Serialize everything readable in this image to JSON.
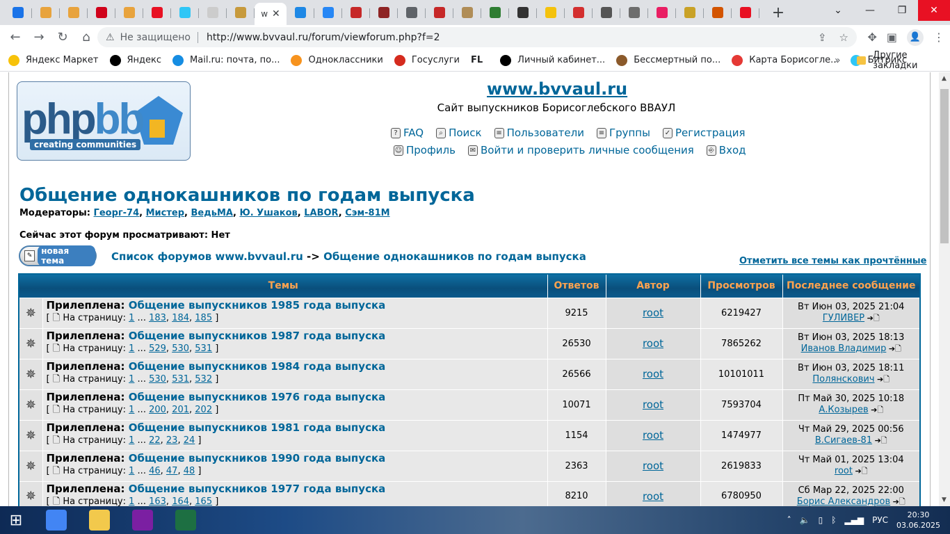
{
  "browser": {
    "active_tab_title": "w",
    "tabs": [
      {
        "icon": "chat-icon",
        "color": "#1a73e8"
      },
      {
        "icon": "mt-icon",
        "color": "#e8a33d"
      },
      {
        "icon": "mt-icon",
        "color": "#e8a33d"
      },
      {
        "icon": "star-icon",
        "color": "#d0021b"
      },
      {
        "icon": "mt-icon",
        "color": "#e8a33d"
      },
      {
        "icon": "red-circle-icon",
        "color": "#e81123"
      },
      {
        "icon": "bitrix24-icon",
        "color": "#2fc6f6"
      },
      {
        "icon": "yandex-icon",
        "color": "#cccccc"
      },
      {
        "icon": "sunburst-icon",
        "color": "#c79a3c"
      }
    ],
    "tabs_right": [
      {
        "icon": "ibb-icon",
        "color": "#1e88e5"
      },
      {
        "icon": "vk-icon",
        "color": "#2787f5"
      },
      {
        "icon": "red-star-icon",
        "color": "#c62828"
      },
      {
        "icon": "red-star-icon",
        "color": "#8e2424"
      },
      {
        "icon": "globe-icon",
        "color": "#5f6368"
      },
      {
        "icon": "mascot-icon",
        "color": "#c62828"
      },
      {
        "icon": "book-icon",
        "color": "#b08d57"
      },
      {
        "icon": "triangle-icon",
        "color": "#2e7d32"
      },
      {
        "icon": "b28-icon",
        "color": "#333333"
      },
      {
        "icon": "smile-icon",
        "color": "#f4c20d"
      },
      {
        "icon": "m-icon",
        "color": "#d32f2f"
      },
      {
        "icon": "u-icon",
        "color": "#555555"
      },
      {
        "icon": "people-icon",
        "color": "#6d6d6d"
      },
      {
        "icon": "b-icon",
        "color": "#e91e63"
      },
      {
        "icon": "flag-icon",
        "color": "#c9a227"
      },
      {
        "icon": "rss-icon",
        "color": "#d35400"
      },
      {
        "icon": "red-circle-icon",
        "color": "#e81123"
      }
    ],
    "address": {
      "insecure_label": "Не защищено",
      "url": "http://www.bvvaul.ru/forum/viewforum.php?f=2"
    },
    "bookmarks": [
      {
        "label": "Яндекс Маркет",
        "color": "#f7c20a"
      },
      {
        "label": "Яндекс",
        "color": "#000000"
      },
      {
        "label": "Mail.ru: почта, по...",
        "color": "#168de2"
      },
      {
        "label": "Одноклассники",
        "color": "#f7931e"
      },
      {
        "label": "Госуслуги",
        "color": "#d52b1e"
      },
      {
        "label": "Личный кабинет...",
        "color": "#000000"
      },
      {
        "label": "Бессмертный по...",
        "color": "#8b5a2b"
      },
      {
        "label": "Карта Борисогле...",
        "color": "#e53935"
      },
      {
        "label": "Битрикс",
        "color": "#2fc6f6"
      }
    ],
    "bookmark_fl_label": "FL",
    "other_bookmarks": "Другие закладки"
  },
  "site": {
    "logo_text_php": "php",
    "logo_text_bb": "bb",
    "logo_tagline": "creating communities",
    "title": "www.bvvaul.ru",
    "description": "Сайт выпускников Борисоглебского ВВАУЛ",
    "nav_top": [
      "FAQ",
      "Поиск",
      "Пользователи",
      "Группы",
      "Регистрация"
    ],
    "nav_bottom": [
      "Профиль",
      "Войти и проверить личные сообщения",
      "Вход"
    ]
  },
  "forum": {
    "title": "Общение однокашников по годам выпуска",
    "moderators_label": "Модераторы:",
    "moderators": [
      "Георг-74",
      "Мистер",
      "ВедьМА",
      "Ю. Ушаков",
      "LABOR",
      "Сэм-81М"
    ],
    "viewing": "Сейчас этот форум просматривают: Нет",
    "new_topic_label": "новая тема",
    "crumb_index": "Список форумов www.bvvaul.ru",
    "crumb_sep": "->",
    "crumb_current": "Общение однокашников по годам выпуска",
    "mark_read": "Отметить все темы как прочтённые",
    "columns": [
      "Темы",
      "Ответов",
      "Автор",
      "Просмотров",
      "Последнее сообщение"
    ],
    "sticky_prefix": "Прилеплена:",
    "pages_label": "На страницу:",
    "rows": [
      {
        "title": "Общение выпускников 1985 года выпуска",
        "pages": [
          "1",
          "183",
          "184",
          "185"
        ],
        "replies": "9215",
        "author": "root",
        "views": "6219427",
        "last_date": "Вт Июн 03, 2025 21:04",
        "last_user": "ГУЛИВЕР"
      },
      {
        "title": "Общение выпускников 1987 года выпуска",
        "pages": [
          "1",
          "529",
          "530",
          "531"
        ],
        "replies": "26530",
        "author": "root",
        "views": "7865262",
        "last_date": "Вт Июн 03, 2025 18:13",
        "last_user": "Иванов Владимир"
      },
      {
        "title": "Общение выпускников 1984 года выпуска",
        "pages": [
          "1",
          "530",
          "531",
          "532"
        ],
        "replies": "26566",
        "author": "root",
        "views": "10101011",
        "last_date": "Вт Июн 03, 2025 18:11",
        "last_user": "Полянскович"
      },
      {
        "title": "Общение выпускников 1976 года выпуска",
        "pages": [
          "1",
          "200",
          "201",
          "202"
        ],
        "replies": "10071",
        "author": "root",
        "views": "7593704",
        "last_date": "Пт Май 30, 2025 10:18",
        "last_user": "А.Козырев"
      },
      {
        "title": "Общение выпускников 1981 года выпуска",
        "pages": [
          "1",
          "22",
          "23",
          "24"
        ],
        "replies": "1154",
        "author": "root",
        "views": "1474977",
        "last_date": "Чт Май 29, 2025 00:56",
        "last_user": "В.Сигаев-81"
      },
      {
        "title": "Общение выпускников 1990 года выпуска",
        "pages": [
          "1",
          "46",
          "47",
          "48"
        ],
        "replies": "2363",
        "author": "root",
        "views": "2619833",
        "last_date": "Чт Май 01, 2025 13:04",
        "last_user": "root"
      },
      {
        "title": "Общение выпускников 1977 года выпуска",
        "pages": [
          "1",
          "163",
          "164",
          "165"
        ],
        "replies": "8210",
        "author": "root",
        "views": "6780950",
        "last_date": "Сб Мар 22, 2025 22:00",
        "last_user": "Борис Александров"
      }
    ]
  },
  "taskbar": {
    "language": "РУС",
    "time": "20:30",
    "date": "03.06.2025",
    "apps": [
      {
        "icon": "chrome-icon",
        "color": "#4285f4"
      },
      {
        "icon": "explorer-icon",
        "color": "#f2c94c"
      },
      {
        "icon": "pdf-icon",
        "color": "#7b1fa2"
      },
      {
        "icon": "excel-icon",
        "color": "#1d6f42"
      }
    ]
  }
}
